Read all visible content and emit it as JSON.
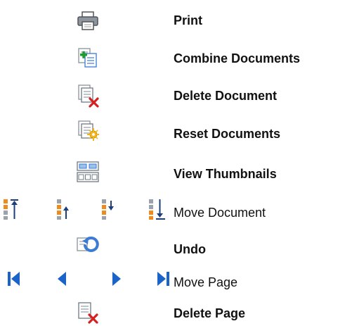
{
  "rows": [
    {
      "label": "Print",
      "icon": "printer-icon"
    },
    {
      "label": "Combine Documents",
      "icon": "combine-documents-icon"
    },
    {
      "label": "Delete Document",
      "icon": "delete-document-icon"
    },
    {
      "label": "Reset Documents",
      "icon": "reset-documents-icon"
    },
    {
      "label": "View Thumbnails",
      "icon": "view-thumbnails-icon"
    },
    {
      "label": "Move Document",
      "icons": [
        "move-document-to-top-icon",
        "move-document-up-icon",
        "move-document-down-icon",
        "move-document-to-bottom-icon"
      ]
    },
    {
      "label": "Undo",
      "icon": "undo-icon"
    },
    {
      "label": "Move Page",
      "icons": [
        "first-page-icon",
        "previous-page-icon",
        "next-page-icon",
        "last-page-icon"
      ]
    },
    {
      "label": "Delete Page",
      "icon": "delete-page-icon"
    }
  ],
  "colors": {
    "text": "#111111",
    "doc_gray": "#9aa3ad",
    "doc_blue": "#3b7bd4",
    "plus_green": "#1e9a2f",
    "delete_red": "#d62020",
    "reset_yellow": "#f2b51e",
    "arrow_orange": "#f08a1c",
    "nav_blue": "#1a63c8"
  }
}
